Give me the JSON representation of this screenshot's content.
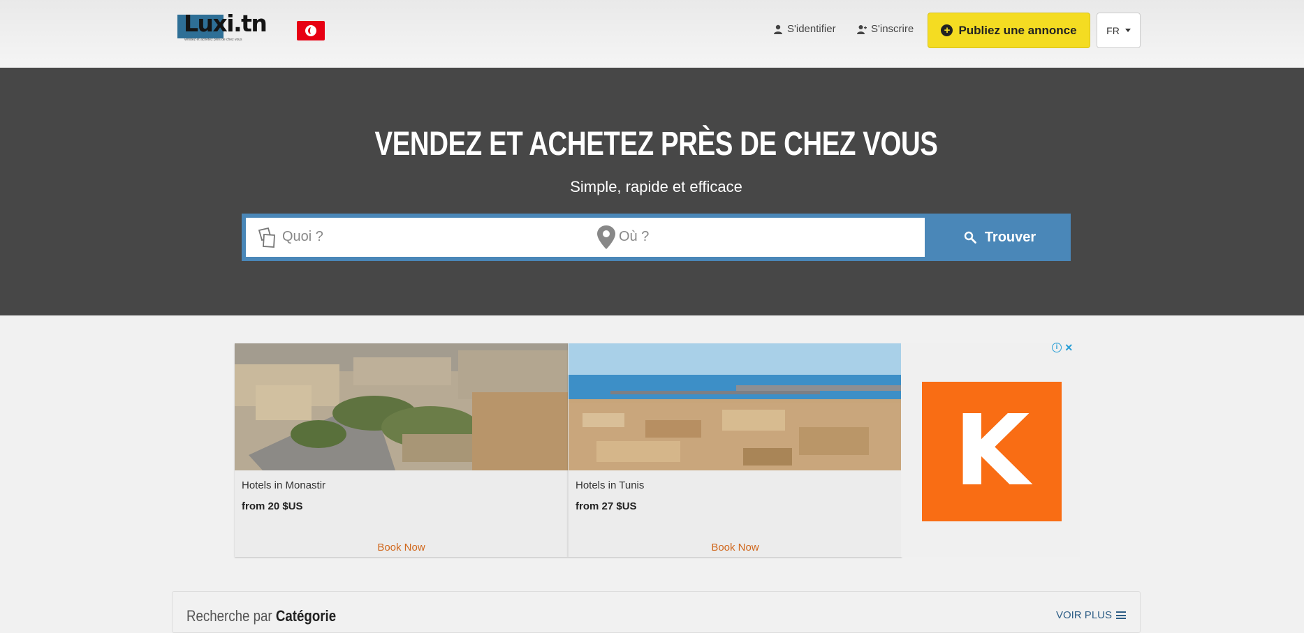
{
  "header": {
    "logo_text": "Luxi.tn",
    "logo_tagline": "vendez et achetez près de chez vous",
    "flag": "tunisia-flag",
    "login_label": "S'identifier",
    "register_label": "S'inscrire",
    "publish_label": "Publiez une annonce",
    "language_label": "FR",
    "accent_yellow": "#f4dc22"
  },
  "hero": {
    "title": "VENDEZ ET ACHETEZ PRÈS DE CHEZ VOUS",
    "subtitle": "Simple, rapide et efficace",
    "what_placeholder": "Quoi ?",
    "where_placeholder": "Où ?",
    "search_label": "Trouver",
    "background": "#474747",
    "search_color": "#4a87b8"
  },
  "ad": {
    "cards": [
      {
        "name": "Hotels in Monastir",
        "price": "from 20 $US",
        "cta": "Book Now"
      },
      {
        "name": "Hotels in Tunis",
        "price": "from 27 $US",
        "cta": "Book Now"
      }
    ],
    "brand_letter": "K",
    "info_icon": "info-icon",
    "close_icon": "close-icon",
    "brand_color": "#f96d14"
  },
  "category": {
    "title_prefix": "Recherche par ",
    "title_bold": "Catégorie",
    "more_label": "VOIR PLUS"
  }
}
